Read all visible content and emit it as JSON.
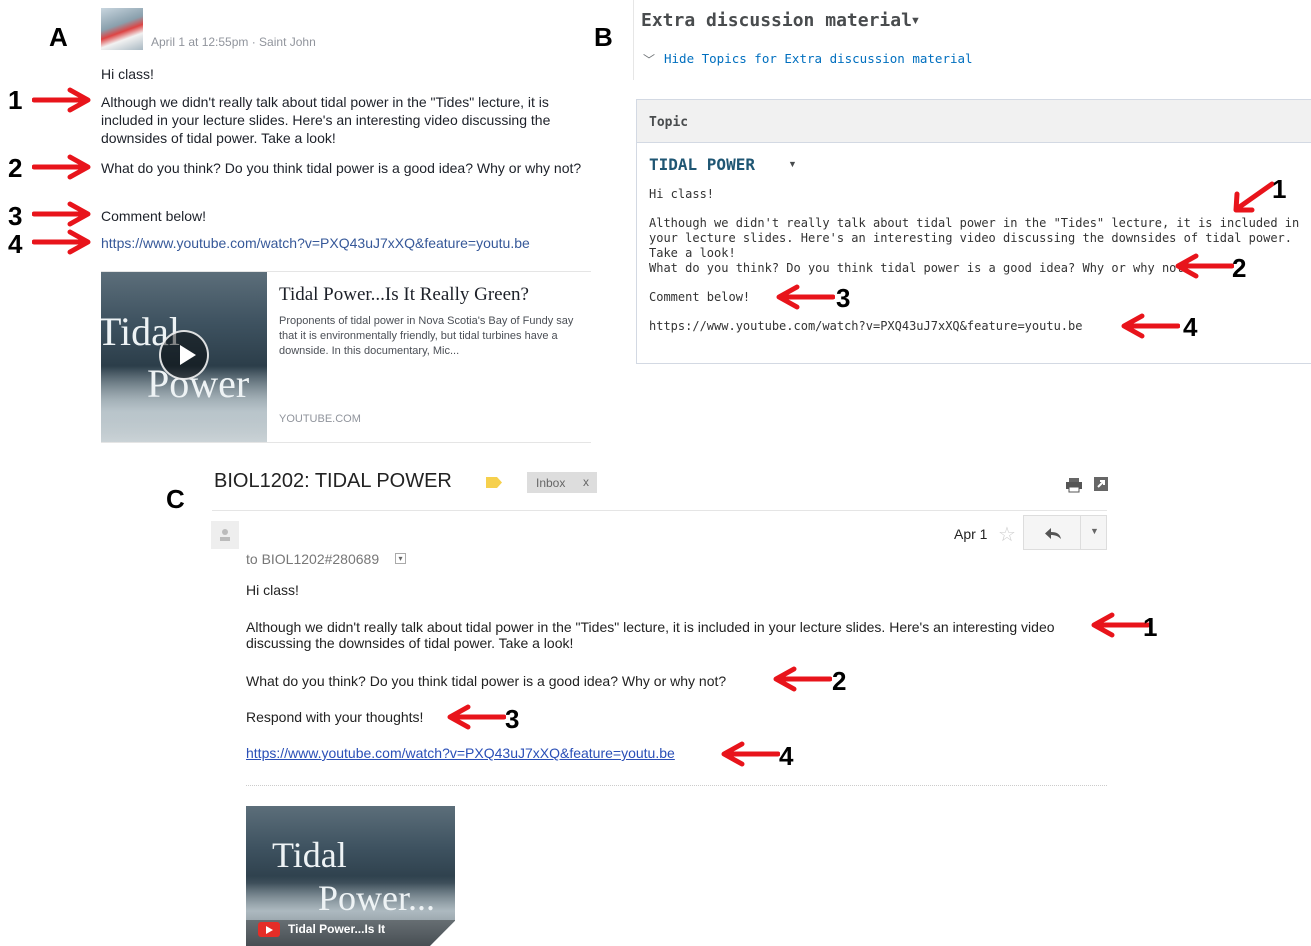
{
  "panels": {
    "a": "A",
    "b": "B",
    "c": "C"
  },
  "panel_a": {
    "meta": "April 1 at 12:55pm · Saint John",
    "greeting": "Hi class!",
    "para1": "Although we didn't really talk about tidal power in the \"Tides\" lecture, it is included in your lecture slides. Here's an interesting video discussing the downsides of tidal power. Take a look!",
    "para2": "What do you think? Do you think tidal power is a good idea? Why or why not?",
    "para3": "Comment below!",
    "link": "https://www.youtube.com/watch?v=PXQ43uJ7xXQ&feature=youtu.be",
    "preview": {
      "thumb_word1": "Tidal",
      "thumb_word2": "Power",
      "title": "Tidal Power...Is It Really Green?",
      "description": "Proponents of tidal power in Nova Scotia's Bay of Fundy say that it is environmentally friendly, but tidal turbines have a downside. In this documentary, Mic...",
      "source": "YOUTUBE.COM"
    }
  },
  "panel_b": {
    "title": "Extra discussion material",
    "hide_topics": "Hide Topics for Extra discussion material",
    "topic_header": "Topic",
    "topic_title": "TIDAL POWER",
    "greeting": "Hi class!",
    "para1": "Although we didn't really talk about tidal power in the \"Tides\" lecture, it is included in your lecture slides. Here's an interesting video discussing the downsides of tidal power. Take a look!",
    "para2": "What do you think? Do you think tidal power is a good idea? Why or why not?",
    "para3": "Comment below!",
    "link": "https://www.youtube.com/watch?v=PXQ43uJ7xXQ&feature=youtu.be"
  },
  "panel_c": {
    "subject": "BIOL1202: TIDAL POWER",
    "inbox_label": "Inbox",
    "inbox_close": "x",
    "date": "Apr 1",
    "to": "to BIOL1202#280689",
    "greeting": "Hi class!",
    "para1": "Although we didn't really talk about tidal power in the \"Tides\" lecture, it is included in your lecture slides. Here's an interesting video discussing the downsides of tidal power. Take a look!",
    "para2": "What do you think? Do you think tidal power is a good idea? Why or why not?",
    "para3": "Respond with your thoughts!",
    "link": "https://www.youtube.com/watch?v=PXQ43uJ7xXQ&feature=youtu.be",
    "thumb_word1": "Tidal",
    "thumb_word2": "Power...",
    "thumb_caption": "Tidal Power...Is It"
  },
  "numbers": {
    "n1": "1",
    "n2": "2",
    "n3": "3",
    "n4": "4"
  },
  "colors": {
    "arrow": "#e8141b",
    "fb_link": "#365899",
    "b_topic": "#1f5673",
    "gm_link": "#2a4fb7",
    "label_yellow": "#f6d04d"
  }
}
